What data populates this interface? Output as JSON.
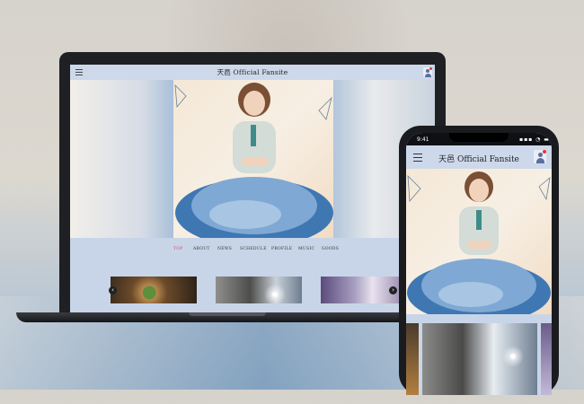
{
  "site": {
    "title": "天邑 Official Fansite"
  },
  "nav": {
    "items": [
      "TOP",
      "ABOUT",
      "NEWS",
      "SCHEDULE",
      "PROFILE",
      "MUSIC",
      "GOODS"
    ],
    "active": "TOP"
  },
  "carousel": {
    "prev_glyph": "‹",
    "next_glyph": "›"
  },
  "phone": {
    "status_time": "9:41",
    "status_icons": "▪▪▪ ◔ ▬"
  },
  "icons": [
    "menu-icon",
    "user-avatar-icon",
    "notification-dot",
    "chevron-left-icon",
    "chevron-right-icon"
  ],
  "colors": {
    "header_bg": "#cdd8ea",
    "nav_active": "#d24a6e",
    "notification": "#e33333"
  }
}
